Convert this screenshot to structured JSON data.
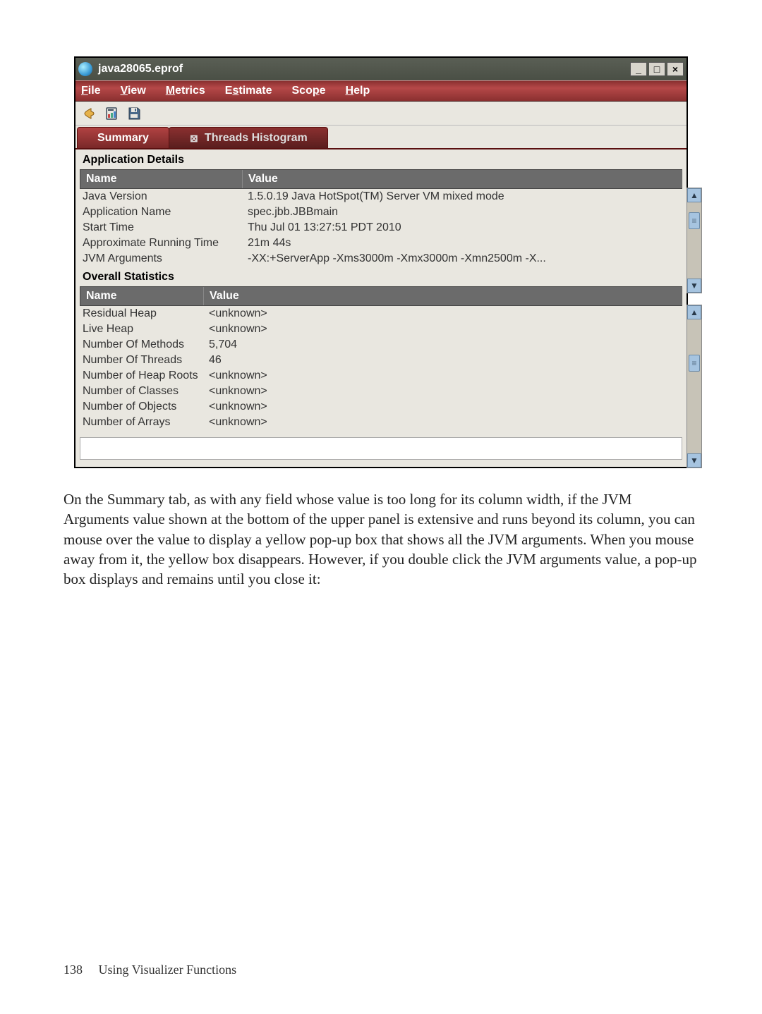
{
  "window": {
    "title": "java28065.eprof",
    "minimize_glyph": "_",
    "maximize_glyph": "□",
    "close_glyph": "×"
  },
  "menubar": {
    "items": [
      {
        "mnemonic": "F",
        "rest": "ile"
      },
      {
        "mnemonic": "V",
        "rest": "iew"
      },
      {
        "mnemonic": "M",
        "rest": "etrics"
      },
      {
        "mnemonic": "",
        "rest_pre": "E",
        "mn_mid": "s",
        "rest_post": "timate"
      },
      {
        "mnemonic": "",
        "rest_pre": "Sco",
        "mn_mid": "p",
        "rest_post": "e"
      },
      {
        "mnemonic": "H",
        "rest": "elp"
      }
    ]
  },
  "tabs": {
    "active": {
      "label": "Summary"
    },
    "inactive": {
      "label": "Threads Histogram",
      "close_glyph": "⊠"
    }
  },
  "application_details": {
    "section_title": "Application Details",
    "col_name": "Name",
    "col_value": "Value",
    "rows": [
      {
        "name": "Java Version",
        "value": "1.5.0.19 Java HotSpot(TM) Server VM mixed mode"
      },
      {
        "name": "Application Name",
        "value": "spec.jbb.JBBmain"
      },
      {
        "name": "Start Time",
        "value": "Thu Jul 01 13:27:51 PDT 2010"
      },
      {
        "name": "Approximate Running Time",
        "value": "21m 44s"
      },
      {
        "name": "JVM Arguments",
        "value": "-XX:+ServerApp -Xms3000m -Xmx3000m -Xmn2500m -X..."
      }
    ]
  },
  "overall_statistics": {
    "section_title": "Overall Statistics",
    "col_name": "Name",
    "col_value": "Value",
    "rows": [
      {
        "name": "Residual Heap",
        "value": "<unknown>"
      },
      {
        "name": "Live Heap",
        "value": "<unknown>"
      },
      {
        "name": "Number Of Methods",
        "value": "5,704"
      },
      {
        "name": "Number Of Threads",
        "value": "46"
      },
      {
        "name": "Number of Heap Roots",
        "value": "<unknown>"
      },
      {
        "name": "Number of Classes",
        "value": "<unknown>"
      },
      {
        "name": "Number of Objects",
        "value": "<unknown>"
      },
      {
        "name": "Number of Arrays",
        "value": "<unknown>"
      }
    ]
  },
  "paragraph": "On the Summary tab, as with any field whose value is too long for its column width, if the JVM Arguments value shown at the bottom of the upper panel is extensive and runs beyond its column, you can mouse over the value to display a yellow pop-up box that shows all the JVM arguments. When you mouse away from it, the yellow box disappears. However, if you double click the JVM arguments value, a pop-up box displays and remains until you close it:",
  "footer": {
    "page_number": "138",
    "chapter": "Using Visualizer Functions"
  },
  "icons": {
    "up_glyph": "▲",
    "down_glyph": "▼"
  }
}
